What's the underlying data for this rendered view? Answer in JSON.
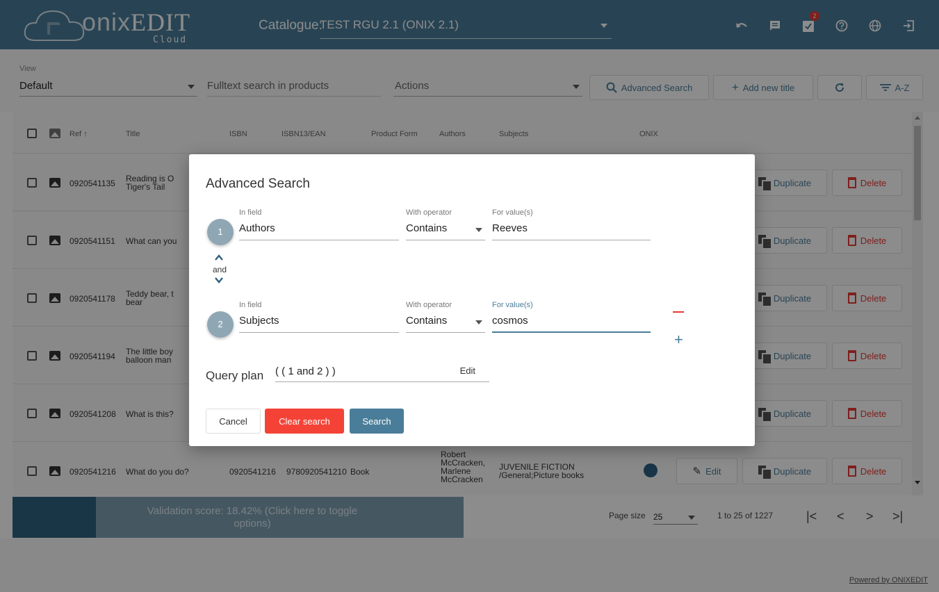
{
  "topbar": {
    "logo_main": "ONIX",
    "logo_thin": "onix",
    "logo_bold": "EDIT",
    "logo_sub": "Cloud",
    "catalogue_label": "Catalogue:",
    "catalogue_value": "TEST RGU 2.1 (ONIX 2.1)",
    "notifications_count": "2",
    "icons": [
      "undo-icon",
      "message-icon",
      "task-check-icon",
      "help-icon",
      "globe-icon",
      "logout-icon"
    ]
  },
  "toolbar": {
    "view_label": "View",
    "view_value": "Default",
    "fulltext_placeholder": "Fulltext search in products",
    "actions_label": "Actions",
    "advanced_search_label": "Advanced Search",
    "add_new_title_label": "Add new title",
    "sort_label": "A-Z"
  },
  "table": {
    "headers": {
      "ref": "Ref",
      "title": "Title",
      "isbn": "ISBN",
      "isbn13": "ISBN13/EAN",
      "product_form": "Product Form",
      "authors": "Authors",
      "subjects": "Subjects",
      "onix": "ONIX"
    },
    "rows": [
      {
        "ref": "0920541135",
        "title_line1": "Reading is O",
        "title_line2": "Tiger's Tail"
      },
      {
        "ref": "0920541151",
        "title_line1": "What can you",
        "title_line2": ""
      },
      {
        "ref": "0920541178",
        "title_line1": "Teddy bear, t",
        "title_line2": "bear"
      },
      {
        "ref": "0920541194",
        "title_line1": "The little boy",
        "title_line2": "balloon man"
      },
      {
        "ref": "0920541208",
        "title_line1": "What is this?",
        "title_line2": ""
      },
      {
        "ref": "0920541216",
        "title_line1": "What do you do?",
        "title_line2": "",
        "isbn": "0920541216",
        "isbn13": "9780920541210",
        "product_form": "Book",
        "authors_lines": [
          "Robert",
          "McCracken,",
          "Marlene",
          "McCracken"
        ],
        "subjects_line1": "JUVENILE FICTION",
        "subjects_line2": "/General;Picture books"
      }
    ],
    "edit_label": "Edit",
    "duplicate_label": "Duplicate",
    "delete_label": "Delete"
  },
  "footer": {
    "validation_text": "Validation score: 18.42% (Click here to toggle options)",
    "validation_fraction": 0.1842,
    "page_size_label": "Page size",
    "page_size_value": "25",
    "range_text": "1 to 25 of 1227",
    "powered_by": "Powered by ONIXEDIT"
  },
  "modal": {
    "title": "Advanced Search",
    "field_label": "In field",
    "operator_label": "With operator",
    "value_label": "For value(s)",
    "criteria": [
      {
        "step": "1",
        "field": "Authors",
        "operator": "Contains",
        "value": "Reeves"
      },
      {
        "step": "2",
        "field": "Subjects",
        "operator": "Contains",
        "value": "cosmos"
      }
    ],
    "connector": "and",
    "query_plan_label": "Query plan",
    "query_plan_value": "( ( 1 and 2 ) )",
    "query_plan_edit": "Edit",
    "cancel_label": "Cancel",
    "clear_label": "Clear search",
    "search_label": "Search"
  },
  "colors": {
    "primary": "#4a7d99",
    "danger": "#f44336",
    "validation_fill": "#2f6380"
  }
}
